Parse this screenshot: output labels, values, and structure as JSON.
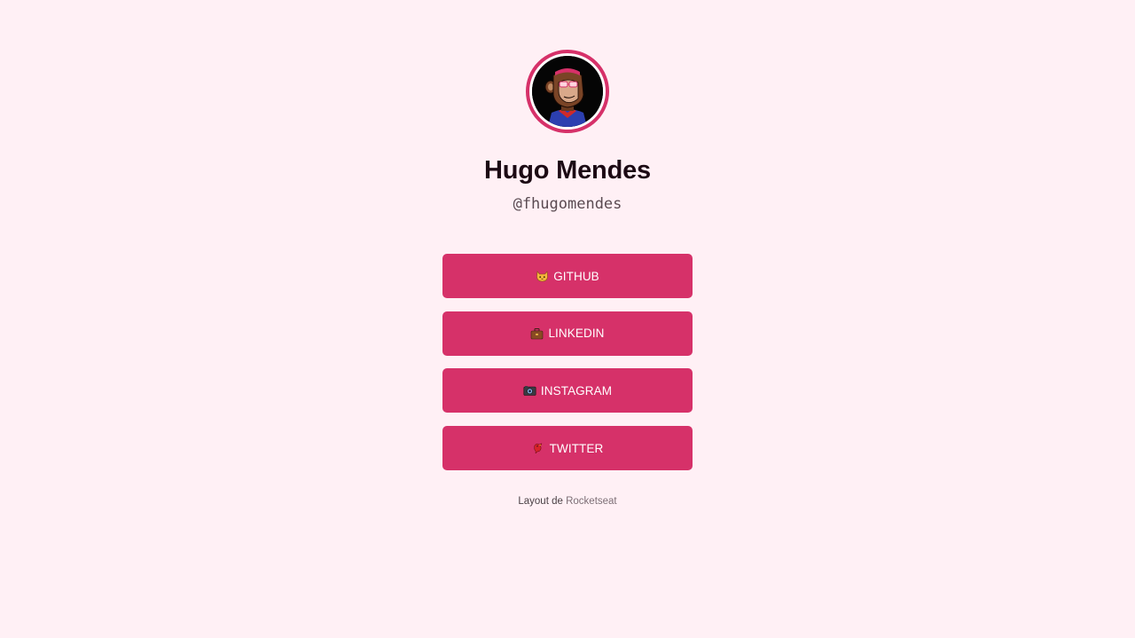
{
  "profile": {
    "name": "Hugo Mendes",
    "handle": "@fhugomendes",
    "avatar_alt": "avatar"
  },
  "links": [
    {
      "label": "GITHUB",
      "icon": "cat-icon"
    },
    {
      "label": "LINKEDIN",
      "icon": "briefcase-icon"
    },
    {
      "label": "INSTAGRAM",
      "icon": "camera-icon"
    },
    {
      "label": "TWITTER",
      "icon": "bird-icon"
    }
  ],
  "footer": {
    "prefix": "Layout de",
    "link_text": "Rocketseat"
  },
  "colors": {
    "background": "#fff0f5",
    "accent": "#d63169",
    "name_text": "#1c0a14"
  }
}
